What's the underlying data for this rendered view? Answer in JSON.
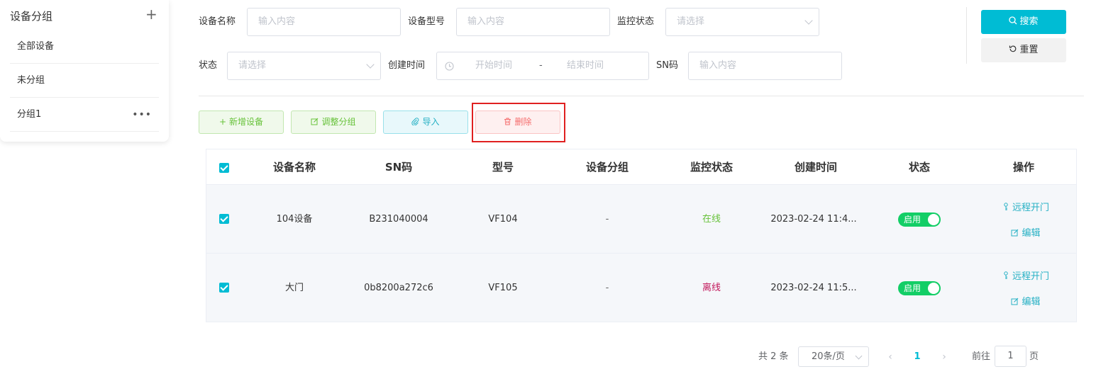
{
  "sidebar": {
    "title": "设备分组",
    "add_icon": "+",
    "items": [
      {
        "label": "全部设备"
      },
      {
        "label": "未分组"
      },
      {
        "label": "分组1",
        "more": "•••"
      }
    ]
  },
  "filters": {
    "device_name": {
      "label": "设备名称",
      "placeholder": "输入内容"
    },
    "device_model": {
      "label": "设备型号",
      "placeholder": "输入内容"
    },
    "monitor_status": {
      "label": "监控状态",
      "placeholder": "请选择"
    },
    "status": {
      "label": "状态",
      "placeholder": "请选择"
    },
    "created_time": {
      "label": "创建时间",
      "start_placeholder": "开始时间",
      "separator": "-",
      "end_placeholder": "结束时间"
    },
    "sn": {
      "label": "SN码",
      "placeholder": "输入内容"
    }
  },
  "buttons": {
    "search": "搜索",
    "reset": "重置",
    "add_device": "新增设备",
    "adjust_group": "调整分组",
    "import": "导入",
    "delete": "删除"
  },
  "table": {
    "headers": [
      "设备名称",
      "SN码",
      "型号",
      "设备分组",
      "监控状态",
      "创建时间",
      "状态",
      "操作"
    ],
    "rows": [
      {
        "name": "104设备",
        "sn": "B231040004",
        "model": "VF104",
        "group": "-",
        "monitor": "在线",
        "monitor_color": "#67c23a",
        "created": "2023-02-24 11:4...",
        "status": "启用",
        "op_open": "远程开门",
        "op_edit": "编辑"
      },
      {
        "name": "大门",
        "sn": "0b8200a272c6",
        "model": "VF105",
        "group": "-",
        "monitor": "离线",
        "monitor_color": "#c2185b",
        "created": "2023-02-24 11:5...",
        "status": "启用",
        "op_open": "远程开门",
        "op_edit": "编辑"
      }
    ]
  },
  "pagination": {
    "total": "共 2 条",
    "page_size": "20条/页",
    "current": "1",
    "goto_label": "前往",
    "goto_value": "1",
    "page_suffix": "页"
  },
  "colors": {
    "accent": "#00bcd4",
    "toggle_on": "#13ce66",
    "highlight": "#e02020"
  }
}
